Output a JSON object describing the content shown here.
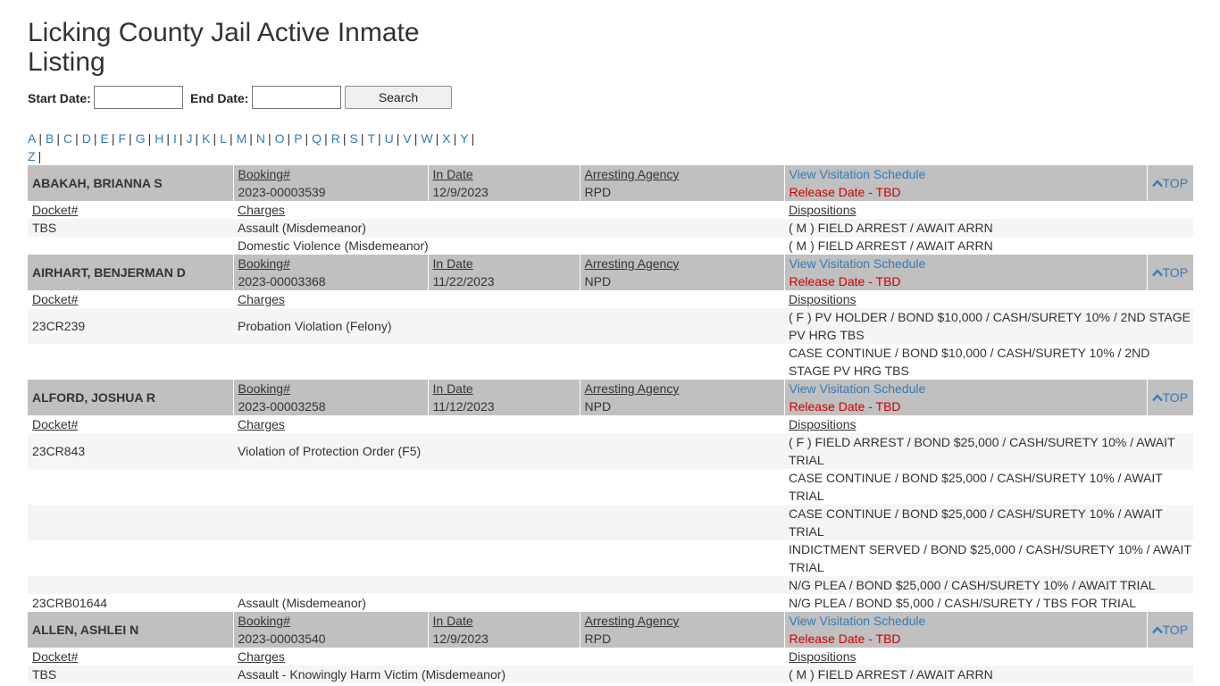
{
  "page": {
    "title": "Licking County Jail Active Inmate Listing"
  },
  "search": {
    "start_label": "Start Date:",
    "end_label": "End Date:",
    "start_value": "",
    "end_value": "",
    "button_label": "Search"
  },
  "alphabet": [
    "A",
    "B",
    "C",
    "D",
    "E",
    "F",
    "G",
    "H",
    "I",
    "J",
    "K",
    "L",
    "M",
    "N",
    "O",
    "P",
    "Q",
    "R",
    "S",
    "T",
    "U",
    "V",
    "W",
    "X",
    "Y",
    "Z"
  ],
  "labels": {
    "booking": "Booking#",
    "in_date": "In Date",
    "agency": "Arresting Agency",
    "visitation": "View Visitation Schedule",
    "top": "TOP",
    "docket": "Docket#",
    "charges": "Charges",
    "dispositions": "Dispositions"
  },
  "colors": {
    "link": "#337ab7",
    "release": "#cc0000",
    "header_bg": "#c0c0c0",
    "row_alt": "#f5f5f5"
  },
  "icons": {
    "top": "chevron-up-icon"
  },
  "inmates": [
    {
      "name": "ABAKAH, BRIANNA S",
      "booking": "2023-00003539",
      "in_date": "12/9/2023",
      "agency": "RPD",
      "release": "Release Date - TBD",
      "rows": [
        {
          "docket": "TBS",
          "charge": "Assault (Misdemeanor)",
          "disposition": "( M ) FIELD ARREST / AWAIT ARRN"
        },
        {
          "docket": "",
          "charge": "Domestic Violence (Misdemeanor)",
          "disposition": "( M ) FIELD ARREST / AWAIT ARRN"
        }
      ]
    },
    {
      "name": "AIRHART, BENJERMAN D",
      "booking": "2023-00003368",
      "in_date": "11/22/2023",
      "agency": "NPD",
      "release": "Release Date - TBD",
      "rows": [
        {
          "docket": "23CR239",
          "charge": "Probation Violation (Felony)",
          "disposition": "( F ) PV HOLDER / BOND $10,000 / CASH/SURETY 10% / 2ND STAGE PV HRG TBS"
        },
        {
          "docket": "",
          "charge": "",
          "disposition": "CASE CONTINUE / BOND $10,000 / CASH/SURETY 10% / 2ND STAGE PV HRG TBS"
        }
      ]
    },
    {
      "name": "ALFORD, JOSHUA R",
      "booking": "2023-00003258",
      "in_date": "11/12/2023",
      "agency": "NPD",
      "release": "Release Date - TBD",
      "rows": [
        {
          "docket": "23CR843",
          "charge": "Violation of Protection Order (F5)",
          "disposition": "( F ) FIELD ARREST / BOND $25,000 / CASH/SURETY 10% / AWAIT TRIAL"
        },
        {
          "docket": "",
          "charge": "",
          "disposition": "CASE CONTINUE / BOND $25,000 / CASH/SURETY 10% / AWAIT TRIAL"
        },
        {
          "docket": "",
          "charge": "",
          "disposition": "CASE CONTINUE / BOND $25,000 / CASH/SURETY 10% / AWAIT TRIAL"
        },
        {
          "docket": "",
          "charge": "",
          "disposition": "INDICTMENT SERVED / BOND $25,000 / CASH/SURETY 10% / AWAIT TRIAL"
        },
        {
          "docket": "",
          "charge": "",
          "disposition": "N/G PLEA / BOND $25,000 / CASH/SURETY 10% / AWAIT TRIAL"
        },
        {
          "docket": "23CRB01644",
          "charge": "Assault (Misdemeanor)",
          "disposition": "N/G PLEA / BOND $5,000 / CASH/SURETY / TBS FOR TRIAL"
        }
      ]
    },
    {
      "name": "ALLEN, ASHLEI N",
      "booking": "2023-00003540",
      "in_date": "12/9/2023",
      "agency": "RPD",
      "release": "Release Date - TBD",
      "rows": [
        {
          "docket": "TBS",
          "charge": "Assault - Knowingly Harm Victim (Misdemeanor)",
          "disposition": "( M ) FIELD ARREST / AWAIT ARRN"
        }
      ]
    }
  ]
}
